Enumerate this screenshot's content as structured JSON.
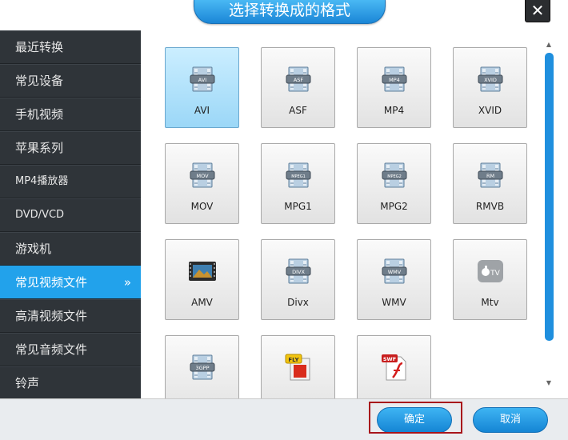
{
  "dialog": {
    "title": "选择转换成的格式",
    "close_label": "✕"
  },
  "sidebar": {
    "items": [
      {
        "label": "最近转换"
      },
      {
        "label": "常见设备"
      },
      {
        "label": "手机视频"
      },
      {
        "label": "苹果系列"
      },
      {
        "label": "MP4播放器"
      },
      {
        "label": "DVD/VCD"
      },
      {
        "label": "游戏机"
      },
      {
        "label": "常见视频文件",
        "active": true,
        "arrow": "»"
      },
      {
        "label": "高清视频文件"
      },
      {
        "label": "常见音频文件"
      },
      {
        "label": "铃声"
      }
    ]
  },
  "formats": [
    {
      "label": "AVI",
      "badge": "AVI",
      "icon": "film-icon",
      "selected": true
    },
    {
      "label": "ASF",
      "badge": "ASF",
      "icon": "film-icon"
    },
    {
      "label": "MP4",
      "badge": "MP4",
      "icon": "film-icon"
    },
    {
      "label": "XVID",
      "badge": "XVID",
      "icon": "film-icon"
    },
    {
      "label": "MOV",
      "badge": "MOV",
      "icon": "film-icon"
    },
    {
      "label": "MPG1",
      "badge": "MPEG1",
      "icon": "film-icon"
    },
    {
      "label": "MPG2",
      "badge": "MPEG2",
      "icon": "film-icon"
    },
    {
      "label": "RMVB",
      "badge": "RM",
      "icon": "film-icon"
    },
    {
      "label": "AMV",
      "badge": "",
      "icon": "amv-film-icon"
    },
    {
      "label": "Divx",
      "badge": "DIVX",
      "icon": "film-icon"
    },
    {
      "label": "WMV",
      "badge": "WMV",
      "icon": "film-icon"
    },
    {
      "label": "Mtv",
      "badge": "TV",
      "icon": "apple-tv-icon"
    },
    {
      "label": "",
      "badge": "3GPP",
      "icon": "film-icon"
    },
    {
      "label": "",
      "badge": "FLY",
      "icon": "flv-icon"
    },
    {
      "label": "",
      "badge": "SWF",
      "icon": "swf-flash-icon"
    }
  ],
  "footer": {
    "ok_label": "确定",
    "cancel_label": "取消"
  },
  "colors": {
    "accent": "#22a2eb",
    "sidebar_bg": "#2f3439",
    "highlight_border": "#a8151b"
  }
}
